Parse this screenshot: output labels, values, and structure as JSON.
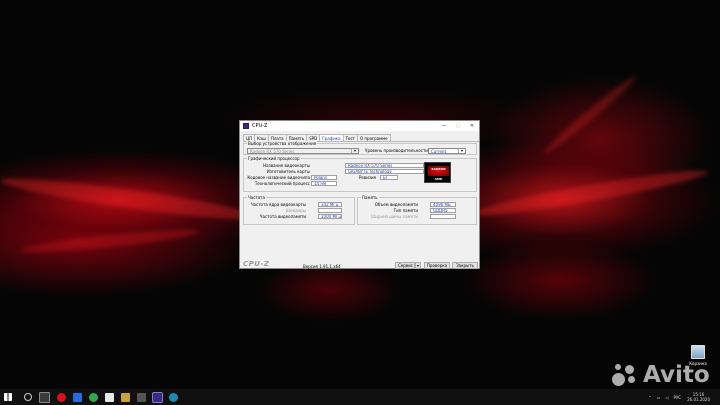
{
  "window": {
    "title": "CPU-Z",
    "minimize": "—",
    "maximize": "□",
    "close": "✕"
  },
  "tabs": [
    "ЦП",
    "Кэш",
    "Плата",
    "Память",
    "SPD",
    "Графика",
    "Тест",
    "О программе"
  ],
  "active_tab": "Графика",
  "device_group": {
    "title": "Выбор устройства отображения",
    "device_value": "Radeon RX 570 Series",
    "perf_label": "Уровень производительности",
    "perf_value": "Current"
  },
  "gpu_group": {
    "title": "Графический процессор",
    "name_label": "Название видеокарты",
    "name_value": "Radeon RX 570 Series",
    "vendor_label": "Изготовитель карты",
    "vendor_value": "GIGABYTE Technology",
    "codename_label": "Кодовое название видеочипа",
    "codename_value": "Polaris",
    "revision_label": "Ревизия",
    "revision_value": "EF",
    "tech_label": "Технологический процесс",
    "tech_value": "14 нм"
  },
  "logo": {
    "line1": "RADEON",
    "line2": "AMD"
  },
  "clocks_group": {
    "title": "Частота",
    "core_label": "Частота ядра видеокарты",
    "core_value": "342 МГц",
    "shader_label": "Шейдеры",
    "shader_value": "",
    "mem_label": "Частота видеопамяти",
    "mem_value": "1000 МГц"
  },
  "memory_group": {
    "title": "Память",
    "size_label": "Объем видеопамяти",
    "size_value": "4096 МБ",
    "type_label": "Тип памяти",
    "type_value": "GDDR5",
    "bus_label": "Ширина шины памяти",
    "bus_value": ""
  },
  "footer": {
    "logo": "CPU-Z",
    "version": "Версия 1.91.1.x64",
    "service_label": "Сервис",
    "verify_label": "Проверка",
    "close_label": "Закрыть"
  },
  "desktop": {
    "recycle_label": "Корзина",
    "watermark": "Avito"
  },
  "taskbar": {
    "lang": "РУС",
    "time": "15:16",
    "date": "26.01.2020"
  },
  "colors": {
    "accent_text": "#1b3bb8",
    "window_bg": "#f0f0f0",
    "desktop_red": "#c80a14"
  }
}
